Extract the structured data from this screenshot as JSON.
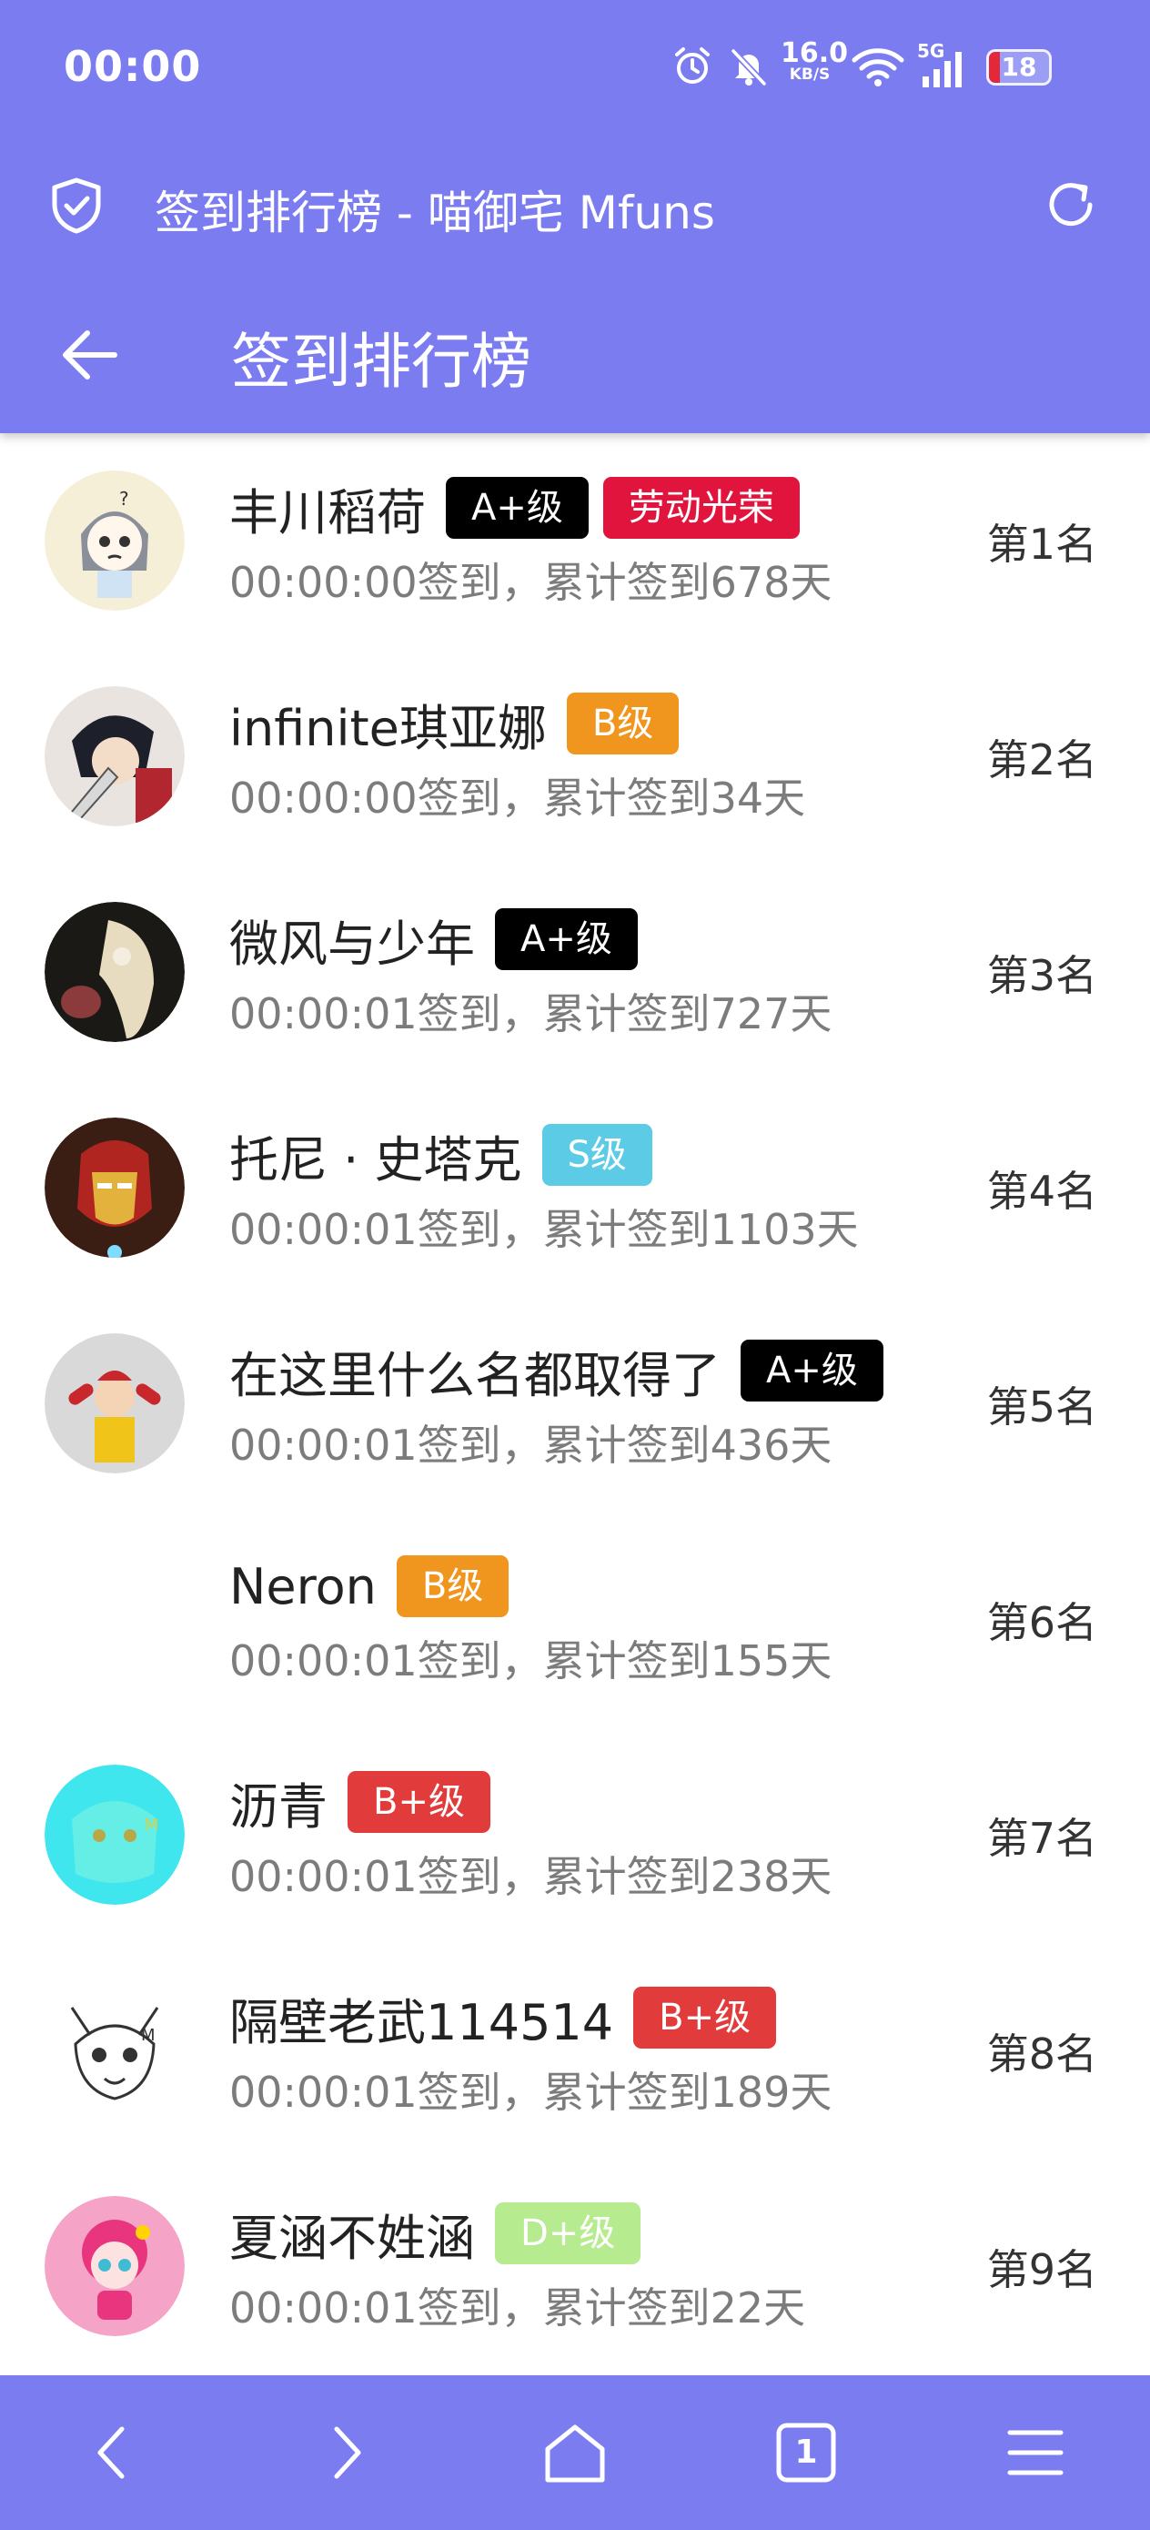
{
  "status_bar": {
    "time": "00:00",
    "net_speed_value": "16.0",
    "net_speed_unit": "KB/S",
    "network": "5G",
    "battery": "18"
  },
  "browser": {
    "page_title": "签到排行榜 - 喵御宅 Mfuns"
  },
  "header": {
    "title": "签到排行榜"
  },
  "colors": {
    "accent": "#7b7cf0",
    "badge_a_plus": "#000000",
    "badge_b": "#f0961e",
    "badge_s": "#5ccbe5",
    "badge_b_plus": "#e23b3b",
    "badge_d_plus": "#b7eb8f",
    "badge_honor": "#e0143c"
  },
  "rows": [
    {
      "name": "丰川稻荷",
      "badges": [
        {
          "text": "A+级",
          "color": "#000000"
        },
        {
          "text": "劳动光荣",
          "color": "#e0143c"
        }
      ],
      "detail": "00:00:00签到，累计签到678天",
      "rank": "第1名",
      "avatar": "avatar-anime-girl"
    },
    {
      "name": "infinite琪亚娜",
      "badges": [
        {
          "text": "B级",
          "color": "#f0961e"
        }
      ],
      "detail": "00:00:00签到，累计签到34天",
      "rank": "第2名",
      "avatar": "avatar-anime-swordsman"
    },
    {
      "name": "微风与少年",
      "badges": [
        {
          "text": "A+级",
          "color": "#000000"
        }
      ],
      "detail": "00:00:01签到，累计签到727天",
      "rank": "第3名",
      "avatar": "avatar-dark-art"
    },
    {
      "name": "托尼 · 史塔克",
      "badges": [
        {
          "text": "S级",
          "color": "#5ccbe5"
        }
      ],
      "detail": "00:00:01签到，累计签到1103天",
      "rank": "第4名",
      "avatar": "avatar-iron-man"
    },
    {
      "name": "在这里什么名都取得了",
      "badges": [
        {
          "text": "A+级",
          "color": "#000000"
        }
      ],
      "detail": "00:00:01签到，累计签到436天",
      "rank": "第5名",
      "avatar": "avatar-clown"
    },
    {
      "name": "Neron",
      "badges": [
        {
          "text": "B级",
          "color": "#f0961e"
        }
      ],
      "detail": "00:00:01签到，累计签到155天",
      "rank": "第6名",
      "avatar": "avatar-empty"
    },
    {
      "name": "沥青",
      "badges": [
        {
          "text": "B+级",
          "color": "#e23b3b"
        }
      ],
      "detail": "00:00:01签到，累计签到238天",
      "rank": "第7名",
      "avatar": "avatar-cyan-anime"
    },
    {
      "name": "隔壁老武114514",
      "badges": [
        {
          "text": "B+级",
          "color": "#e23b3b"
        }
      ],
      "detail": "00:00:01签到，累计签到189天",
      "rank": "第8名",
      "avatar": "avatar-sketch-cat"
    },
    {
      "name": "夏涵不姓涵",
      "badges": [
        {
          "text": "D+级",
          "color": "#b7eb8f"
        }
      ],
      "detail": "00:00:01签到，累计签到22天",
      "rank": "第9名",
      "avatar": "avatar-pink-cartoon"
    }
  ],
  "bottom_nav": {
    "tab_count": "1"
  }
}
